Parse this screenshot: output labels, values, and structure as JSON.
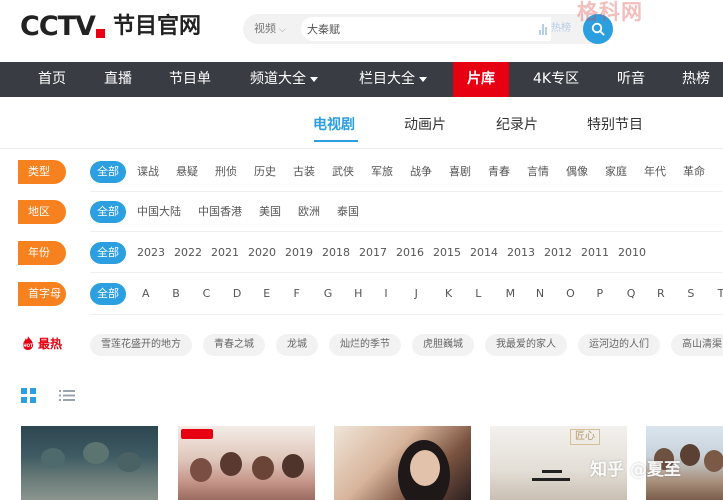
{
  "header": {
    "logo_cctv": "CCTV",
    "logo_title": "节目官网",
    "search_category": "视频",
    "search_value": "大秦赋",
    "hot_rank_label": "热榜"
  },
  "watermark_top": "格科网",
  "watermark_bottom": "知乎 @夏至",
  "nav": {
    "items": [
      {
        "label": "首页"
      },
      {
        "label": "直播"
      },
      {
        "label": "节目单"
      },
      {
        "label": "频道大全"
      },
      {
        "label": "栏目大全"
      },
      {
        "label": "片库"
      },
      {
        "label": "4K专区"
      },
      {
        "label": "听音"
      },
      {
        "label": "热榜"
      }
    ]
  },
  "tabs": [
    {
      "label": "电视剧"
    },
    {
      "label": "动画片"
    },
    {
      "label": "纪录片"
    },
    {
      "label": "特别节目"
    }
  ],
  "filters": {
    "all_label": "全部",
    "rows": [
      {
        "label": "类型",
        "options": [
          "谍战",
          "悬疑",
          "刑侦",
          "历史",
          "古装",
          "武侠",
          "军旅",
          "战争",
          "喜剧",
          "青春",
          "言情",
          "偶像",
          "家庭",
          "年代",
          "革命"
        ]
      },
      {
        "label": "地区",
        "options": [
          "中国大陆",
          "中国香港",
          "美国",
          "欧洲",
          "泰国"
        ]
      },
      {
        "label": "年份",
        "options": [
          "2023",
          "2022",
          "2021",
          "2020",
          "2019",
          "2018",
          "2017",
          "2016",
          "2015",
          "2014",
          "2013",
          "2012",
          "2011",
          "2010"
        ]
      },
      {
        "label": "首字母",
        "options": [
          "A",
          "B",
          "C",
          "D",
          "E",
          "F",
          "G",
          "H",
          "I",
          "J",
          "K",
          "L",
          "M",
          "N",
          "O",
          "P",
          "Q",
          "R",
          "S",
          "T"
        ]
      }
    ]
  },
  "hottest": {
    "badge": "HOT",
    "label": "最热",
    "tags": [
      "雪莲花盛开的地方",
      "青春之城",
      "龙城",
      "灿烂的季节",
      "虎胆巍城",
      "我最爱的家人",
      "运河边的人们",
      "高山清渠"
    ]
  },
  "thumbs": {
    "t4_seal": "匠心"
  },
  "colors": {
    "accent_blue": "#2c9fe0",
    "nav_bg": "#3a3c44",
    "brand_red": "#e60012",
    "filter_orange": "#f7811f"
  }
}
